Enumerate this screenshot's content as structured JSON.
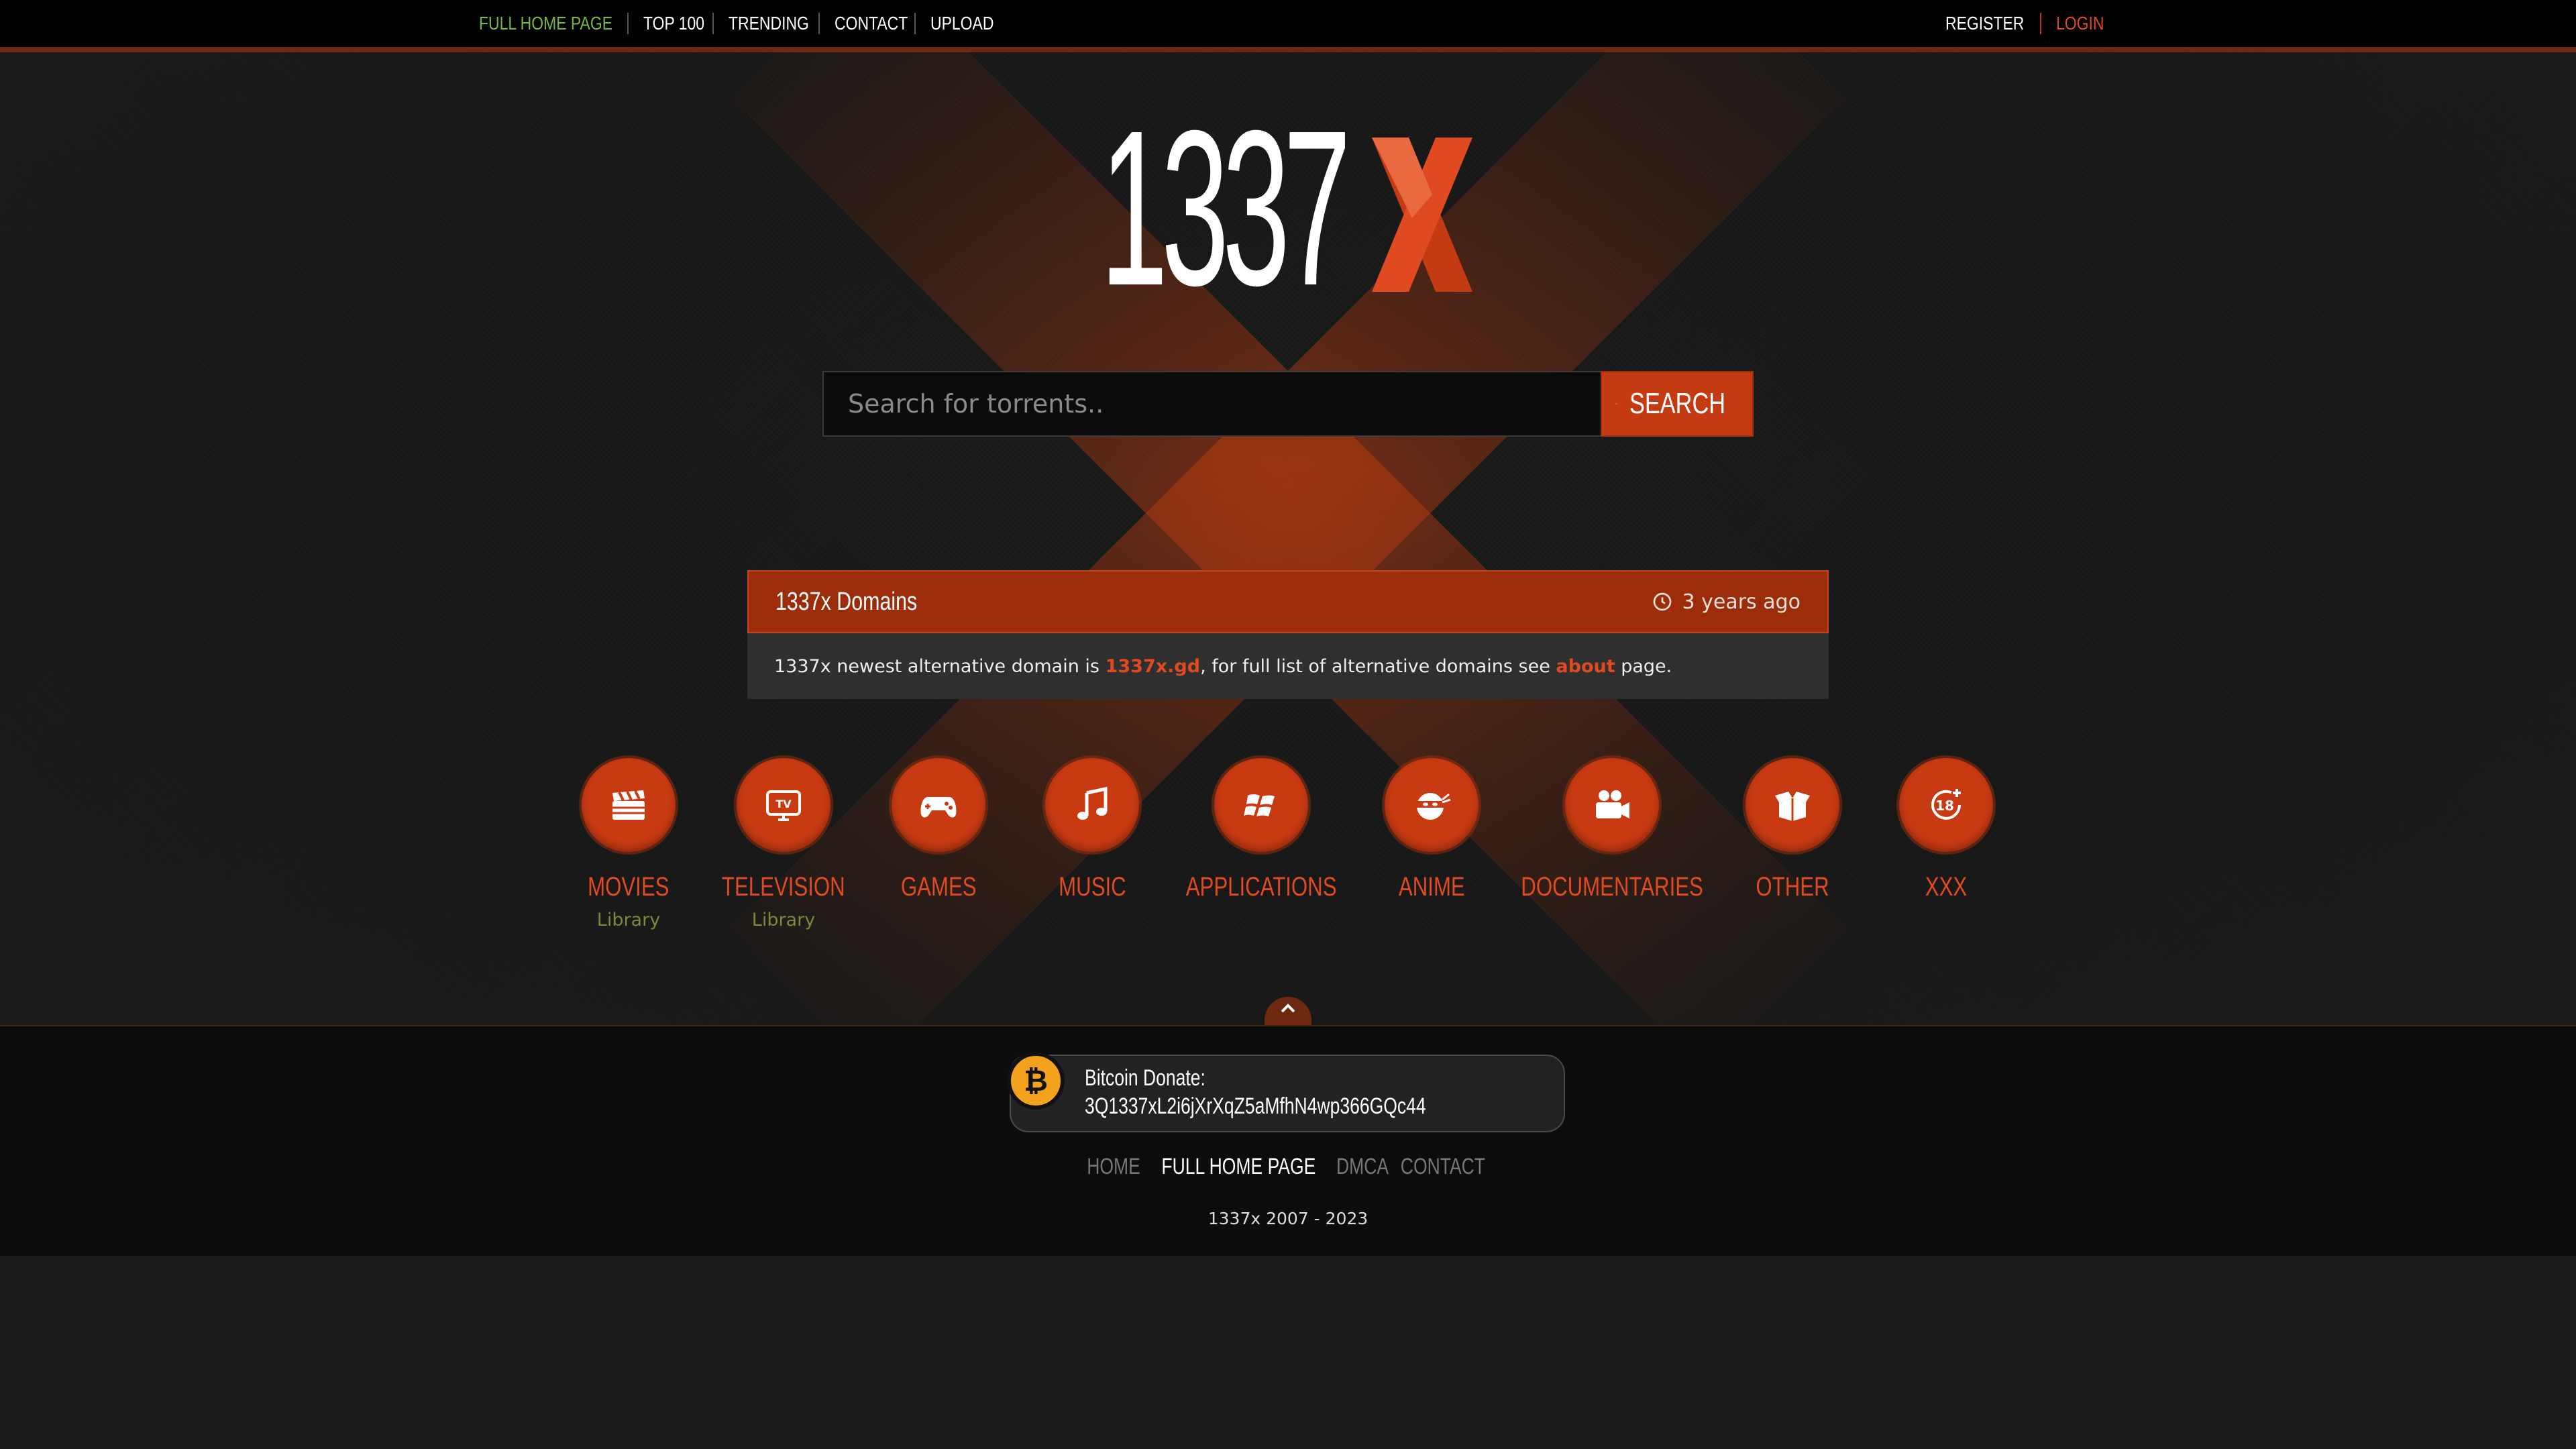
{
  "nav": {
    "left": [
      {
        "label": "FULL HOME PAGE",
        "active": true
      },
      {
        "label": "TOP 100"
      },
      {
        "label": "TRENDING"
      },
      {
        "label": "CONTACT"
      },
      {
        "label": "UPLOAD"
      }
    ],
    "register": "REGISTER",
    "login": "LOGIN"
  },
  "logo": {
    "text": "1337",
    "accent": "X"
  },
  "search": {
    "placeholder": "Search for torrents..",
    "button": "SEARCH"
  },
  "domains": {
    "title": "1337x Domains",
    "time": "3 years ago",
    "text_before": "1337x newest alternative domain is ",
    "link1": "1337x.gd",
    "text_middle": ", for full list of alternative domains see ",
    "link2": "about",
    "text_after": " page."
  },
  "categories": [
    {
      "label": "MOVIES",
      "sub": "Library",
      "icon": "clapperboard-icon"
    },
    {
      "label": "TELEVISION",
      "sub": "Library",
      "icon": "tv-icon"
    },
    {
      "label": "GAMES",
      "icon": "gamepad-icon"
    },
    {
      "label": "MUSIC",
      "icon": "music-note-icon"
    },
    {
      "label": "APPLICATIONS",
      "icon": "windows-icon"
    },
    {
      "label": "ANIME",
      "icon": "ninja-icon"
    },
    {
      "label": "DOCUMENTARIES",
      "icon": "video-camera-icon"
    },
    {
      "label": "OTHER",
      "icon": "open-box-icon"
    },
    {
      "label": "XXX",
      "icon": "adult-18-icon"
    }
  ],
  "footer": {
    "btc_label": "Bitcoin Donate:",
    "btc_address": "3Q1337xL2i6jXrXqZ5aMfhN4wp366GQc44",
    "links": [
      "HOME",
      "FULL HOME PAGE",
      "DMCA",
      "CONTACT"
    ],
    "active_link": "FULL HOME PAGE",
    "copyright": "1337x 2007 - 2023"
  },
  "colors": {
    "accent": "#c43a13",
    "link": "#e04a20",
    "green": "#7ab83b",
    "bitcoin": "#f4a21e"
  }
}
